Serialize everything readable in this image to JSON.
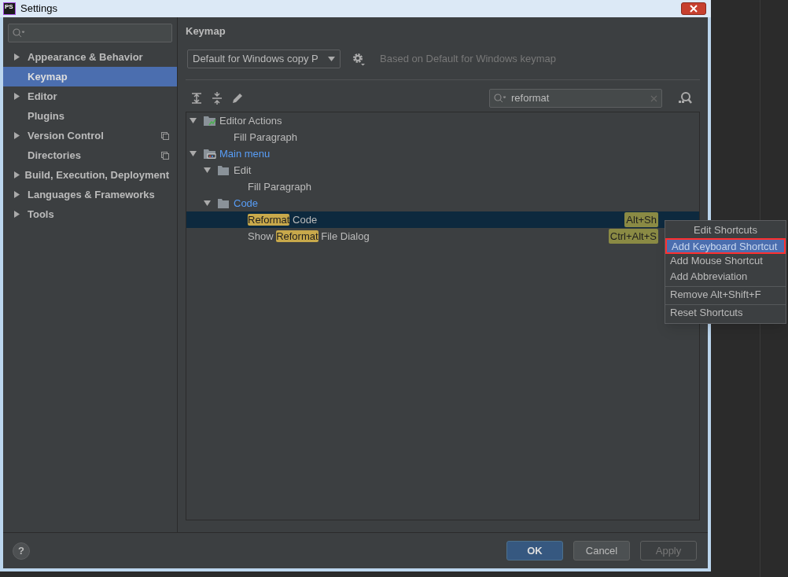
{
  "window": {
    "title": "Settings",
    "app_icon": "PS"
  },
  "sidebar": {
    "items": [
      {
        "label": "Appearance & Behavior",
        "expandable": true,
        "selected": false,
        "project_level": false
      },
      {
        "label": "Keymap",
        "expandable": false,
        "selected": true,
        "project_level": false
      },
      {
        "label": "Editor",
        "expandable": true,
        "selected": false,
        "project_level": false
      },
      {
        "label": "Plugins",
        "expandable": false,
        "selected": false,
        "project_level": false
      },
      {
        "label": "Version Control",
        "expandable": true,
        "selected": false,
        "project_level": true
      },
      {
        "label": "Directories",
        "expandable": false,
        "selected": false,
        "project_level": true
      },
      {
        "label": "Build, Execution, Deployment",
        "expandable": true,
        "selected": false,
        "project_level": false
      },
      {
        "label": "Languages & Frameworks",
        "expandable": true,
        "selected": false,
        "project_level": false
      },
      {
        "label": "Tools",
        "expandable": true,
        "selected": false,
        "project_level": false
      }
    ]
  },
  "keymap": {
    "heading": "Keymap",
    "scheme": "Default for Windows copy P",
    "based_on": "Based on Default for Windows keymap",
    "search": "reformat",
    "tree": [
      {
        "kind": "actions-group",
        "label": [
          {
            "text": "Editor Actions",
            "match": false
          }
        ],
        "modified": false,
        "expanded": true,
        "selected": false,
        "children": [
          {
            "kind": "action",
            "label": [
              {
                "text": "Fill Paragraph",
                "match": false
              }
            ],
            "modified": false,
            "selected": false
          }
        ]
      },
      {
        "kind": "menu",
        "label": [
          {
            "text": "Main menu",
            "match": false
          }
        ],
        "modified": true,
        "expanded": true,
        "selected": false,
        "children": [
          {
            "kind": "folder",
            "label": [
              {
                "text": "Edit",
                "match": false
              }
            ],
            "modified": false,
            "expanded": true,
            "selected": false,
            "children": [
              {
                "kind": "action",
                "label": [
                  {
                    "text": "Fill Paragraph",
                    "match": false
                  }
                ],
                "modified": false,
                "selected": false
              }
            ]
          },
          {
            "kind": "folder",
            "label": [
              {
                "text": "Code",
                "match": false
              }
            ],
            "modified": true,
            "expanded": true,
            "selected": false,
            "children": [
              {
                "kind": "action",
                "label": [
                  {
                    "text": "Reformat",
                    "match": true
                  },
                  {
                    "text": " Code",
                    "match": false
                  }
                ],
                "modified": false,
                "selected": true,
                "shortcut": "Alt+Sh"
              },
              {
                "kind": "action",
                "label": [
                  {
                    "text": "Show ",
                    "match": false
                  },
                  {
                    "text": "Reformat",
                    "match": true
                  },
                  {
                    "text": " File Dialog",
                    "match": false
                  }
                ],
                "modified": false,
                "selected": false,
                "shortcut": "Ctrl+Alt+S"
              }
            ]
          }
        ]
      }
    ]
  },
  "context_menu": {
    "title": "Edit Shortcuts",
    "items": [
      {
        "label": "Add Keyboard Shortcut",
        "selected": true,
        "separator_before": false
      },
      {
        "label": "Add Mouse Shortcut",
        "selected": false,
        "separator_before": false
      },
      {
        "label": "Add Abbreviation",
        "selected": false,
        "separator_before": false
      },
      {
        "label": "Remove Alt+Shift+F",
        "selected": false,
        "separator_before": true
      },
      {
        "label": "Reset Shortcuts",
        "selected": false,
        "separator_before": true
      }
    ]
  },
  "help": "?",
  "buttons": [
    {
      "label": "OK",
      "kind": "default",
      "disabled": false
    },
    {
      "label": "Cancel",
      "kind": "normal",
      "disabled": false
    },
    {
      "label": "Apply",
      "kind": "normal",
      "disabled": true
    }
  ]
}
